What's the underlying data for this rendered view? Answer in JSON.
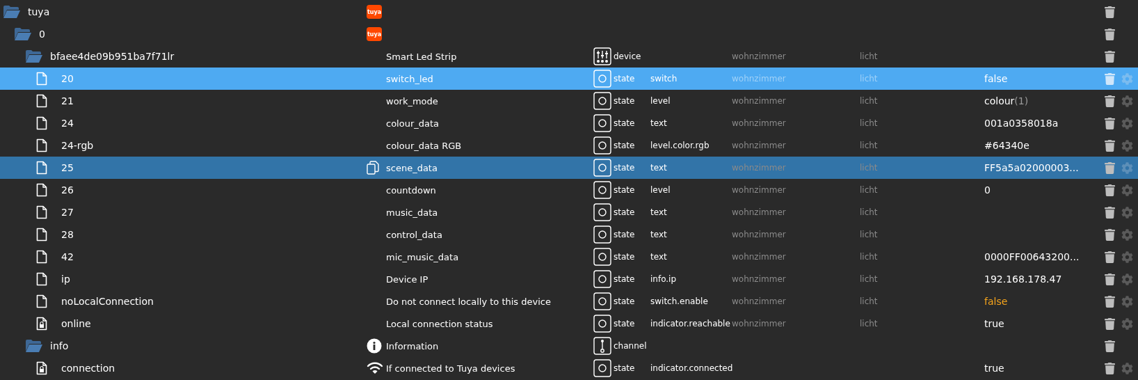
{
  "objects": [
    {
      "id": "tuya",
      "kind": "folder",
      "selected": false,
      "hovered": false,
      "name_icon": {
        "kind": "logo",
        "text": "tuya"
      },
      "children": [
        {
          "id": "0",
          "kind": "folder",
          "selected": false,
          "hovered": false,
          "name_icon": {
            "kind": "logo",
            "text": "tuya"
          },
          "children": [
            {
              "id": "bfaee4de09b951ba7f71lr",
              "kind": "folder",
              "selected": false,
              "hovered": false,
              "name": "Smart Led Strip",
              "object_type": {
                "kind": "device",
                "label": "device"
              },
              "room": "wohnzimmer",
              "function": "licht",
              "children": [
                {
                  "id": "20",
                  "kind": "file",
                  "selected": true,
                  "hovered": false,
                  "name": "switch_led",
                  "object_type": {
                    "kind": "state",
                    "label": "state"
                  },
                  "role": "switch",
                  "room": "wohnzimmer",
                  "function": "licht",
                  "value": "false",
                  "ack": true
                },
                {
                  "id": "21",
                  "kind": "file",
                  "selected": false,
                  "hovered": false,
                  "name": "work_mode",
                  "object_type": {
                    "kind": "state",
                    "label": "state"
                  },
                  "role": "level",
                  "room": "wohnzimmer",
                  "function": "licht",
                  "value": "colour",
                  "value_suffix": "(1)",
                  "ack": true
                },
                {
                  "id": "24",
                  "kind": "file",
                  "selected": false,
                  "hovered": false,
                  "name": "colour_data",
                  "object_type": {
                    "kind": "state",
                    "label": "state"
                  },
                  "role": "text",
                  "room": "wohnzimmer",
                  "function": "licht",
                  "value": "001a0358018a",
                  "ack": true
                },
                {
                  "id": "24-rgb",
                  "kind": "file",
                  "selected": false,
                  "hovered": false,
                  "name": "colour_data RGB",
                  "object_type": {
                    "kind": "state",
                    "label": "state"
                  },
                  "role": "level.color.rgb",
                  "room": "wohnzimmer",
                  "function": "licht",
                  "value": "#64340e",
                  "ack": true
                },
                {
                  "id": "25",
                  "kind": "file",
                  "selected": false,
                  "hovered": true,
                  "name_icon": {
                    "kind": "copy"
                  },
                  "name": "scene_data",
                  "object_type": {
                    "kind": "state",
                    "label": "state"
                  },
                  "role": "text",
                  "room": "wohnzimmer",
                  "function": "licht",
                  "value": "FF5a5a02000003...",
                  "ack": true
                },
                {
                  "id": "26",
                  "kind": "file",
                  "selected": false,
                  "hovered": false,
                  "name": "countdown",
                  "object_type": {
                    "kind": "state",
                    "label": "state"
                  },
                  "role": "level",
                  "room": "wohnzimmer",
                  "function": "licht",
                  "value": "0",
                  "ack": true
                },
                {
                  "id": "27",
                  "kind": "file",
                  "selected": false,
                  "hovered": false,
                  "name": "music_data",
                  "object_type": {
                    "kind": "state",
                    "label": "state"
                  },
                  "role": "text",
                  "room": "wohnzimmer",
                  "function": "licht"
                },
                {
                  "id": "28",
                  "kind": "file",
                  "selected": false,
                  "hovered": false,
                  "name": "control_data",
                  "object_type": {
                    "kind": "state",
                    "label": "state"
                  },
                  "role": "text",
                  "room": "wohnzimmer",
                  "function": "licht"
                },
                {
                  "id": "42",
                  "kind": "file",
                  "selected": false,
                  "hovered": false,
                  "name": "mic_music_data",
                  "object_type": {
                    "kind": "state",
                    "label": "state"
                  },
                  "role": "text",
                  "room": "wohnzimmer",
                  "function": "licht",
                  "value": "0000FF00643200...",
                  "ack": true
                },
                {
                  "id": "ip",
                  "kind": "file",
                  "selected": false,
                  "hovered": false,
                  "name": "Device IP",
                  "object_type": {
                    "kind": "state",
                    "label": "state"
                  },
                  "role": "info.ip",
                  "room": "wohnzimmer",
                  "function": "licht",
                  "value": "192.168.178.47",
                  "ack": true
                },
                {
                  "id": "noLocalConnection",
                  "kind": "file",
                  "selected": false,
                  "hovered": false,
                  "name": "Do not connect locally to this device",
                  "object_type": {
                    "kind": "state",
                    "label": "state"
                  },
                  "role": "switch.enable",
                  "room": "wohnzimmer",
                  "function": "licht",
                  "value": "false",
                  "ack": false
                },
                {
                  "id": "online",
                  "kind": "locked-file",
                  "selected": false,
                  "hovered": false,
                  "name": "Local connection status",
                  "object_type": {
                    "kind": "state",
                    "label": "state"
                  },
                  "role": "indicator.reachable",
                  "room": "wohnzimmer",
                  "function": "licht",
                  "value": "true",
                  "ack": true
                }
              ]
            },
            {
              "id": "info",
              "kind": "folder",
              "selected": false,
              "hovered": false,
              "name_icon": {
                "kind": "info"
              },
              "name": "Information",
              "object_type": {
                "kind": "channel",
                "label": "channel"
              },
              "children": [
                {
                  "id": "connection",
                  "kind": "locked-file",
                  "selected": false,
                  "hovered": false,
                  "name_icon": {
                    "kind": "wifi"
                  },
                  "name": "If connected to Tuya devices",
                  "object_type": {
                    "kind": "state",
                    "label": "state"
                  },
                  "role": "indicator.connected",
                  "value": "true",
                  "ack": true
                }
              ]
            }
          ]
        }
      ]
    }
  ]
}
